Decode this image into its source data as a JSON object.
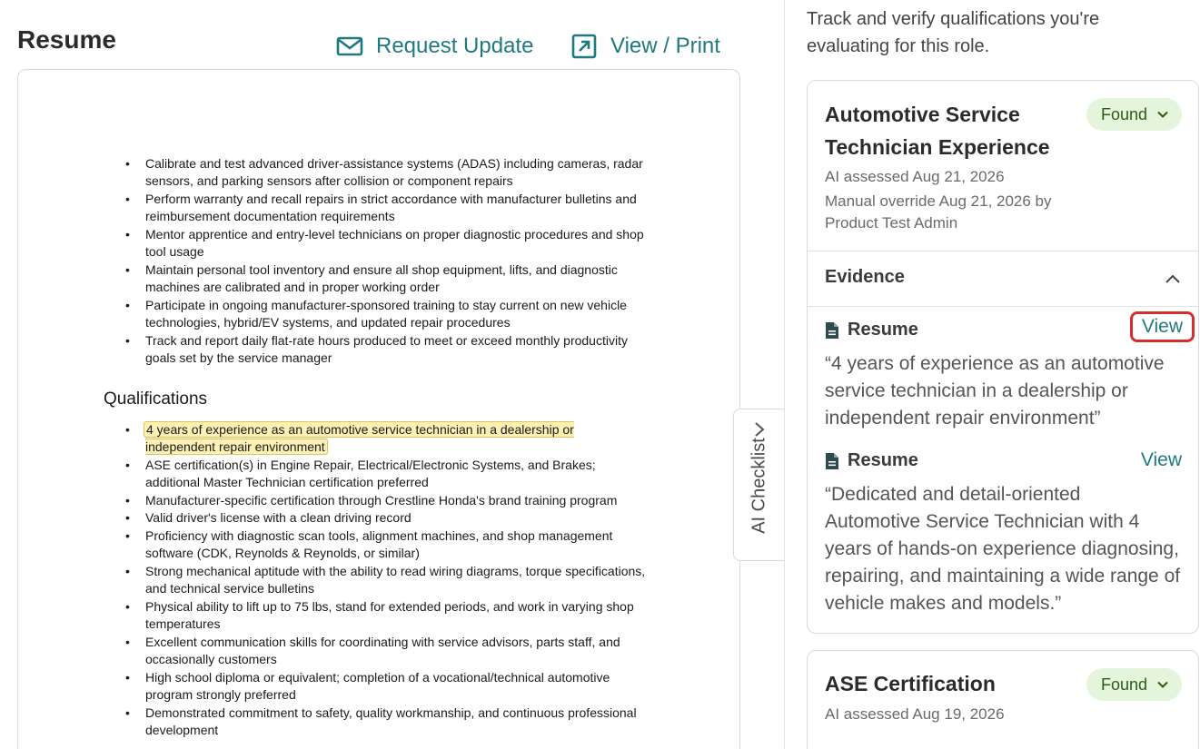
{
  "resume": {
    "title": "Resume",
    "request_update": "Request Update",
    "view_print": "View / Print",
    "bullets_top": [
      [
        "Calibrate and test advanced driver-assistance systems (ADAS) including cameras, radar",
        "sensors, and parking sensors after collision or component repairs"
      ],
      [
        "Perform warranty and recall repairs in strict accordance with manufacturer bulletins and",
        "reimbursement documentation requirements"
      ],
      [
        "Mentor apprentice and entry-level technicians on proper diagnostic procedures and shop",
        "tool usage"
      ],
      [
        "Maintain personal tool inventory and ensure all shop equipment, lifts, and diagnostic",
        "machines are calibrated and in proper working order"
      ],
      [
        "Participate in ongoing manufacturer-sponsored training to stay current on new vehicle",
        "technologies, hybrid/EV systems, and updated repair procedures"
      ],
      [
        "Track and report daily flat-rate hours produced to meet or exceed monthly productivity",
        "goals set by the service manager"
      ]
    ],
    "qualifications_heading": "Qualifications",
    "qualifications": [
      [
        "4 years of experience as an automotive service technician in a dealership or",
        "independent repair environment"
      ],
      [
        "ASE certification(s) in Engine Repair, Electrical/Electronic Systems, and Brakes;",
        "additional Master Technician certification preferred"
      ],
      [
        "Manufacturer-specific certification through Crestline Honda's brand training program"
      ],
      [
        "Valid driver's license with a clean driving record"
      ],
      [
        "Proficiency with diagnostic scan tools, alignment machines, and shop management",
        "software (CDK, Reynolds & Reynolds, or similar)"
      ],
      [
        "Strong mechanical aptitude with the ability to read wiring diagrams, torque specifications,",
        "and technical service bulletins"
      ],
      [
        "Physical ability to lift up to 75 lbs, stand for extended periods, and work in varying shop",
        "temperatures"
      ],
      [
        "Excellent communication skills for coordinating with service advisors, parts staff, and",
        "occasionally customers"
      ],
      [
        "High school diploma or equivalent; completion of a vocational/technical automotive",
        "program strongly preferred"
      ],
      [
        "Demonstrated commitment to safety, quality workmanship, and continuous professional",
        "development"
      ]
    ]
  },
  "tab": {
    "label": "AI Checklist"
  },
  "checklist": {
    "intro": "Track and verify qualifications you're evaluating for this role.",
    "cards": [
      {
        "title_line1": "Automotive Service",
        "title_line2": "Technician Experience",
        "status": "Found",
        "ai_assessed": "AI assessed Aug 21, 2026",
        "override_line1": "Manual override Aug 21, 2026 by",
        "override_line2": "Product Test Admin",
        "evidence_label": "Evidence",
        "evidence": [
          {
            "source": "Resume",
            "view": "View",
            "quote_lines": [
              "“4 years of experience as an automotive",
              "service technician in a dealership or",
              "independent repair environment”"
            ]
          },
          {
            "source": "Resume",
            "view": "View",
            "quote_lines": [
              "“Dedicated and detail-oriented",
              "Automotive Service Technician with 4",
              "years of hands-on experience diagnosing,",
              "repairing, and maintaining a wide range of",
              "vehicle makes and models.”"
            ]
          }
        ]
      },
      {
        "title": "ASE Certification",
        "status": "Found",
        "ai_assessed": "AI assessed Aug 19, 2026"
      }
    ]
  },
  "colors": {
    "accent": "#1f7a80",
    "found_bg": "#e4f5dc",
    "found_text": "#2d5b14",
    "highlight": "#fdf0b4",
    "focus_ring": "#d32f2f"
  }
}
